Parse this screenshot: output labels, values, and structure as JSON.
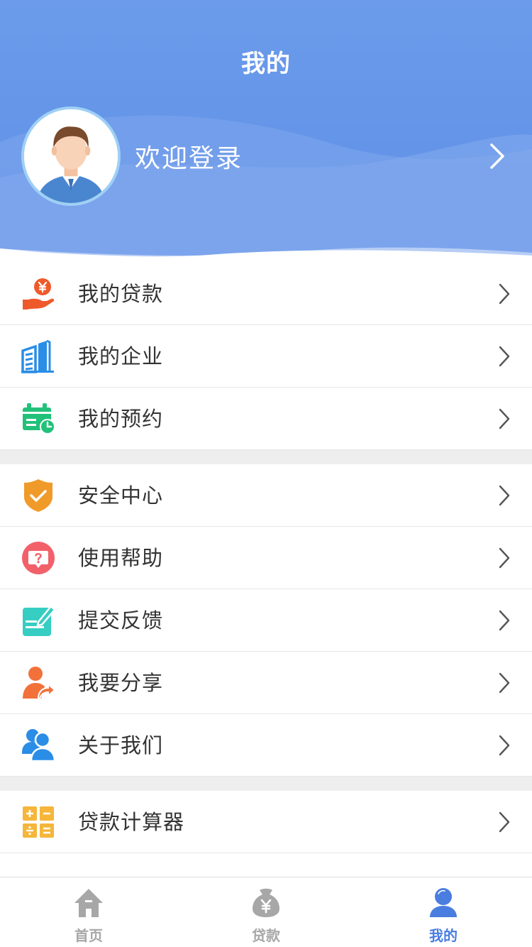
{
  "header": {
    "title": "我的",
    "login_text": "欢迎登录",
    "background_color": "#6b9bea"
  },
  "menu": {
    "group1": [
      {
        "label": "我的贷款",
        "icon": "loan-hand-yen-icon",
        "color": "#ef5a2a"
      },
      {
        "label": "我的企业",
        "icon": "building-icon",
        "color": "#2a8de6"
      },
      {
        "label": "我的预约",
        "icon": "calendar-clock-icon",
        "color": "#22c17a"
      }
    ],
    "group2": [
      {
        "label": "安全中心",
        "icon": "shield-check-icon",
        "color": "#f09a2a"
      },
      {
        "label": "使用帮助",
        "icon": "help-bubble-icon",
        "color": "#f2616a"
      },
      {
        "label": "提交反馈",
        "icon": "feedback-edit-icon",
        "color": "#36cdc2"
      },
      {
        "label": "我要分享",
        "icon": "share-user-icon",
        "color": "#f2713a"
      },
      {
        "label": "关于我们",
        "icon": "users-icon",
        "color": "#2a8de6"
      }
    ],
    "group3": [
      {
        "label": "贷款计算器",
        "icon": "calculator-icon",
        "color": "#f5b63a"
      }
    ]
  },
  "tabbar": {
    "tabs": [
      {
        "label": "首页",
        "icon": "home-icon",
        "active": false
      },
      {
        "label": "贷款",
        "icon": "money-bag-icon",
        "active": false
      },
      {
        "label": "我的",
        "icon": "user-icon",
        "active": true
      }
    ],
    "active_color": "#4a7de0",
    "inactive_color": "#a7a7a7"
  }
}
